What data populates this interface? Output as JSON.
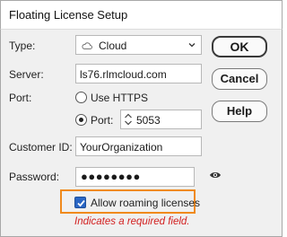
{
  "window": {
    "title": "Floating License Setup"
  },
  "form": {
    "type_label": "Type:",
    "type_value": "Cloud",
    "server_label": "Server:",
    "server_value": "ls76.rlmcloud.com",
    "port_label": "Port:",
    "use_https_label": "Use HTTPS",
    "port_option_label": "Port:",
    "port_value": "5053",
    "customer_id_label": "Customer ID:",
    "customer_id_value": "YourOrganization",
    "password_label": "Password:",
    "password_mask": "●●●●●●●●",
    "allow_roaming_label": "Allow roaming licenses",
    "allow_roaming_checked": true,
    "selected_port_option": "Port",
    "required_note": "Indicates a required field."
  },
  "buttons": {
    "ok": "OK",
    "cancel": "Cancel",
    "help": "Help"
  },
  "colors": {
    "highlight": "#f08a1c",
    "required_text": "#d21f1f",
    "checkbox": "#2a66c4"
  },
  "icons": {
    "type_icon": "cloud-icon",
    "password_toggle": "eye-icon"
  }
}
